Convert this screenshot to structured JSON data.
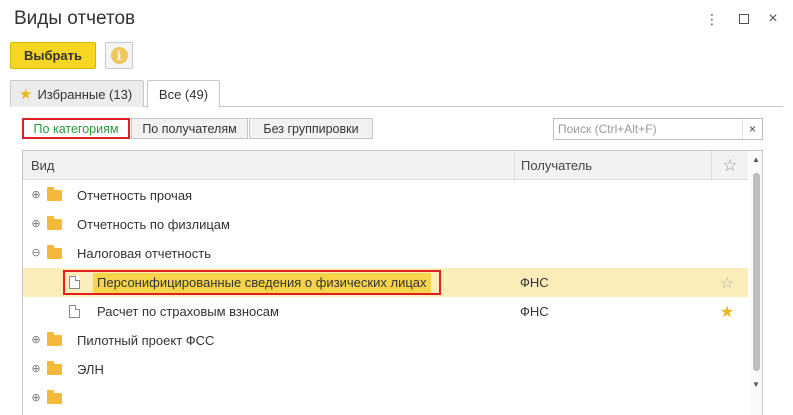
{
  "window": {
    "title": "Виды отчетов",
    "more_glyph": "⋮",
    "close_glyph": "×"
  },
  "toolbar": {
    "select_label": "Выбрать",
    "info_glyph": "i"
  },
  "tabs": [
    {
      "label": "Избранные (13)",
      "active": false
    },
    {
      "label": "Все (49)",
      "active": true
    }
  ],
  "grouping": {
    "buttons": [
      {
        "label": "По категориям",
        "active": true
      },
      {
        "label": "По получателям",
        "active": false
      },
      {
        "label": "Без группировки",
        "active": false
      }
    ]
  },
  "search": {
    "placeholder": "Поиск (Ctrl+Alt+F)",
    "value": "",
    "clear_glyph": "×"
  },
  "table": {
    "columns": [
      "Вид",
      "Получатель",
      "☆"
    ],
    "rows": [
      {
        "label": "Отчетность прочая",
        "type": "folder",
        "expanded": false,
        "receiver": "",
        "favorite": false
      },
      {
        "label": "Отчетность по физлицам",
        "type": "folder",
        "expanded": false,
        "receiver": "",
        "favorite": false
      },
      {
        "label": "Налоговая отчетность",
        "type": "folder",
        "expanded": true,
        "receiver": "",
        "favorite": false
      },
      {
        "label": "Персонифицированные сведения о физических лицах",
        "type": "document",
        "receiver": "ФНС",
        "favorite": false,
        "selected": true
      },
      {
        "label": "Расчет по страховым взносам",
        "type": "document",
        "receiver": "ФНС",
        "favorite": true
      },
      {
        "label": "Пилотный проект ФСС",
        "type": "folder",
        "expanded": false,
        "receiver": "",
        "favorite": false
      },
      {
        "label": "ЭЛН",
        "type": "folder",
        "expanded": false,
        "receiver": "",
        "favorite": false
      }
    ]
  },
  "glyphs": {
    "expand": "⊕",
    "collapse": "⊖",
    "star_empty": "☆",
    "star_filled": "★"
  },
  "colors": {
    "accent_button": "#f6d622",
    "selected_row": "#fbedb9",
    "highlight_text": "#f6d54a",
    "annotation_border": "#e02020",
    "active_group_text": "#2a9a3c",
    "folder": "#f3b93a",
    "star": "#e6b820"
  }
}
